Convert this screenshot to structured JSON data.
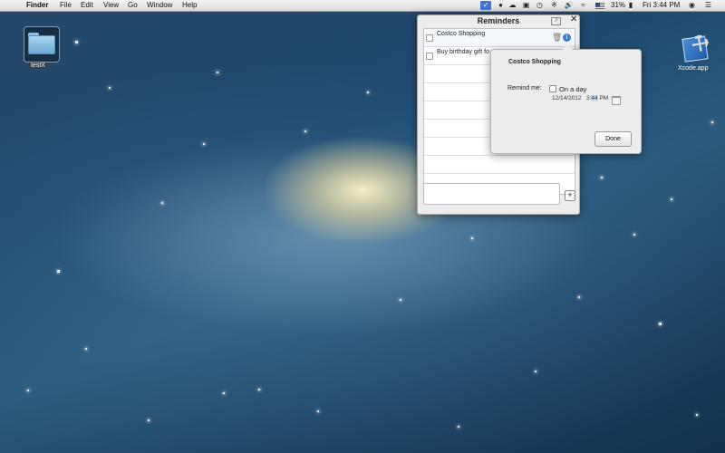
{
  "menubar": {
    "apple_glyph": "",
    "app_name": "Finder",
    "menus": [
      "File",
      "Edit",
      "View",
      "Go",
      "Window",
      "Help"
    ],
    "battery": "31%",
    "clock": "Fri 3:44 PM",
    "reminders_icon_glyph": "✓",
    "list_glyph": "☰"
  },
  "desktop": {
    "folder_label": "testX",
    "xcode_label": "Xcode.app"
  },
  "reminders": {
    "title": "Reminders",
    "close_glyph": "✕",
    "share_glyph": "↗",
    "items": [
      {
        "text": "Costco Shopping",
        "checked": false
      },
      {
        "text": "Buy birthday gift fo",
        "checked": false
      }
    ],
    "trash_glyph": "🗑",
    "info_glyph": "i",
    "add_glyph": "+",
    "new_item_placeholder": ""
  },
  "detail": {
    "title": "Costco Shopping",
    "remind_label": "Remind me:",
    "on_a_day_label": "On a day",
    "on_a_day_checked": false,
    "date": "12/14/2012",
    "time_prefix": "3:",
    "time_highlight": "44",
    "time_suffix": " PM",
    "done_label": "Done"
  }
}
